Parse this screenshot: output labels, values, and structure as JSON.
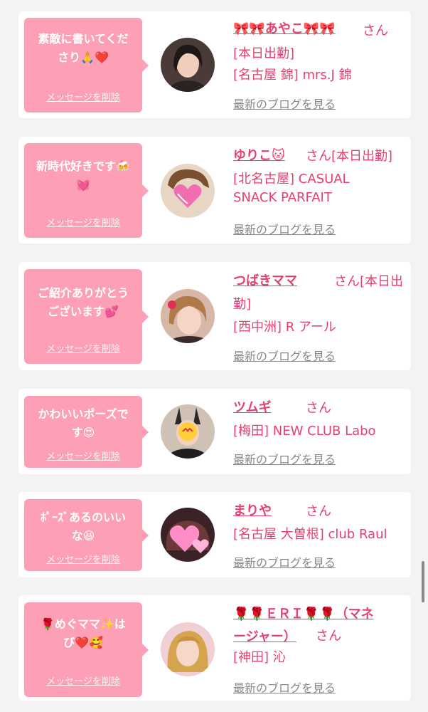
{
  "delete_label": "メッセージを削除",
  "blog_label": "最新のブログを見る",
  "colors": {
    "bubble": "#fea0b5",
    "name": "#e8406e",
    "link": "#888888",
    "card": "#ffffff",
    "background": "#f3f3f3"
  },
  "cards": [
    {
      "message": [
        "素敵に書いてくだ",
        "さり🙏❤️"
      ],
      "name": "🎀🎀あやこ🎀🎀",
      "suffix": "さん",
      "details": [
        "[本日出勤]",
        "[名古屋 錦] mrs.J 錦"
      ],
      "avatar": "woman-with-black-hair-photo"
    },
    {
      "message": [
        "新時代好きです🍻",
        "💓"
      ],
      "name": "ゆりこ🐱",
      "suffix": "さん[本日出勤]",
      "details": [
        "[北名古屋] CASUAL",
        "SNACK PARFAIT"
      ],
      "avatar": "woman-with-heart-covering-face-photo"
    },
    {
      "message": [
        "ご紹介ありがとう",
        "ございます💕"
      ],
      "name": "つばきママ",
      "suffix": "さん[本日出",
      "details": [
        "勤]",
        "[西中洲] R アール"
      ],
      "avatar": "woman-with-blonde-hair-photo"
    },
    {
      "message": [
        "かわいいポーズで",
        "す😍"
      ],
      "name": "ツムギ",
      "suffix": "さん",
      "details": [
        "[梅田] NEW CLUB Labo"
      ],
      "avatar": "woman-bunny-ears-emoji-face-photo"
    },
    {
      "message": [
        "ﾎﾟｰｽﾞあるのいい",
        "な😆"
      ],
      "name": "まりや",
      "suffix": "さん",
      "details": [
        "[名古屋 大曽根] club Raul"
      ],
      "avatar": "pink-hearts-photo"
    },
    {
      "message": [
        "🌹めぐママ✨は",
        "び❤️🥰"
      ],
      "name": [
        "🌹🌹ＥＲＩ🌹🌹（マネ",
        "ージャー）"
      ],
      "suffix": "さん",
      "details": [
        "[神田] 沁"
      ],
      "avatar": "woman-with-blonde-hair-pink-background-photo"
    }
  ]
}
